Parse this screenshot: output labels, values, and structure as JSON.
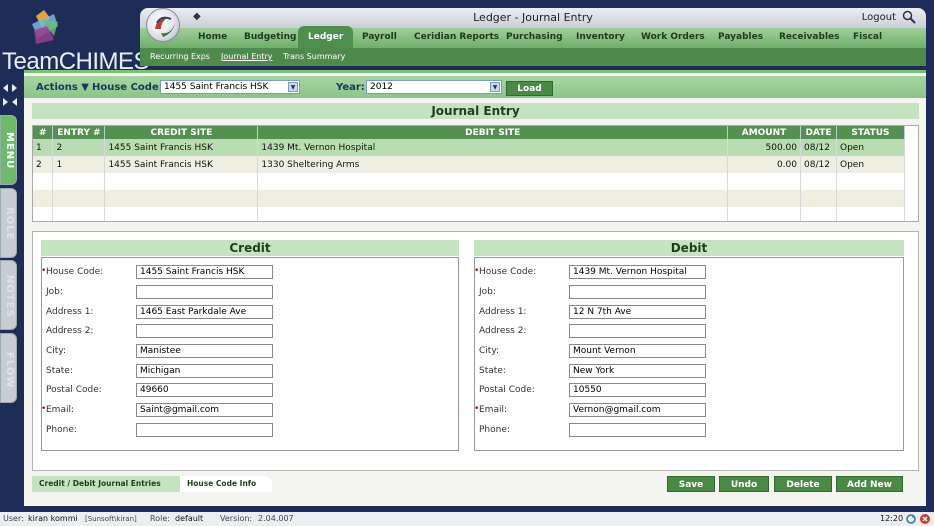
{
  "app": {
    "logo": "TeamCHIMES",
    "window_title": "Ledger - Journal Entry",
    "logout": "Logout"
  },
  "nav": {
    "tabs": [
      "Home",
      "Budgeting",
      "Ledger",
      "Payroll",
      "Ceridian Reports",
      "Purchasing",
      "Inventory",
      "Work Orders",
      "Payables",
      "Receivables",
      "Fiscal"
    ],
    "active": "Ledger"
  },
  "subnav": {
    "items": [
      "Recurring Exps",
      "Journal Entry",
      "Trans Summary"
    ],
    "active": "Journal Entry"
  },
  "sidebar": {
    "tabs": [
      "MENU",
      "ROLE",
      "NOTES",
      "FLOW"
    ]
  },
  "toolbar": {
    "actions_label": "Actions ▼",
    "house_code_label": "House Code:",
    "house_code_value": "1455 Saint Francis HSK",
    "year_label": "Year:",
    "year_value": "2012",
    "load_label": "Load"
  },
  "journal": {
    "title": "Journal Entry",
    "columns": [
      "#",
      "ENTRY #",
      "CREDIT SITE",
      "DEBIT SITE",
      "AMOUNT",
      "DATE",
      "STATUS"
    ],
    "rows": [
      {
        "n": "1",
        "entry": "2",
        "credit": "1455 Saint Francis HSK",
        "debit": "1439 Mt. Vernon Hospital",
        "amount": "500.00",
        "date": "08/12",
        "status": "Open"
      },
      {
        "n": "2",
        "entry": "1",
        "credit": "1455 Saint Francis HSK",
        "debit": "1330 Sheltering Arms",
        "amount": "0.00",
        "date": "08/12",
        "status": "Open"
      }
    ]
  },
  "credit": {
    "title": "Credit",
    "labels": {
      "house_code": "House Code:",
      "job": "Job:",
      "address1": "Address 1:",
      "address2": "Address 2:",
      "city": "City:",
      "state": "State:",
      "postal": "Postal Code:",
      "email": "Email:",
      "phone": "Phone:"
    },
    "values": {
      "house_code": "1455 Saint Francis HSK",
      "job": "",
      "address1": "1465 East Parkdale Ave",
      "address2": "",
      "city": "Manistee",
      "state": "Michigan",
      "postal": "49660",
      "email": "Saint@gmail.com",
      "phone": ""
    }
  },
  "debit": {
    "title": "Debit",
    "labels": {
      "house_code": "House Code:",
      "job": "Job:",
      "address1": "Address 1:",
      "address2": "Address 2:",
      "city": "City:",
      "state": "State:",
      "postal": "Postal Code:",
      "email": "Email:",
      "phone": "Phone:"
    },
    "values": {
      "house_code": "1439 Mt. Vernon Hospital",
      "job": "",
      "address1": "12 N 7th Ave",
      "address2": "",
      "city": "Mount Vernon",
      "state": "New York",
      "postal": "10550",
      "email": "Vernon@gmail.com",
      "phone": ""
    }
  },
  "bottom_tabs": {
    "credit_debit": "Credit / Debit Journal Entries",
    "house_code_info": "House Code Info"
  },
  "buttons": {
    "save": "Save",
    "undo": "Undo",
    "delete": "Delete",
    "add_new": "Add New"
  },
  "status": {
    "user_label": "User:",
    "user": "kiran kommi",
    "user_domain": "[Sunsoft\\kiran]",
    "role_label": "Role:",
    "role": "default",
    "version_label": "Version:",
    "version": "2.04.007",
    "time": "12:20"
  }
}
